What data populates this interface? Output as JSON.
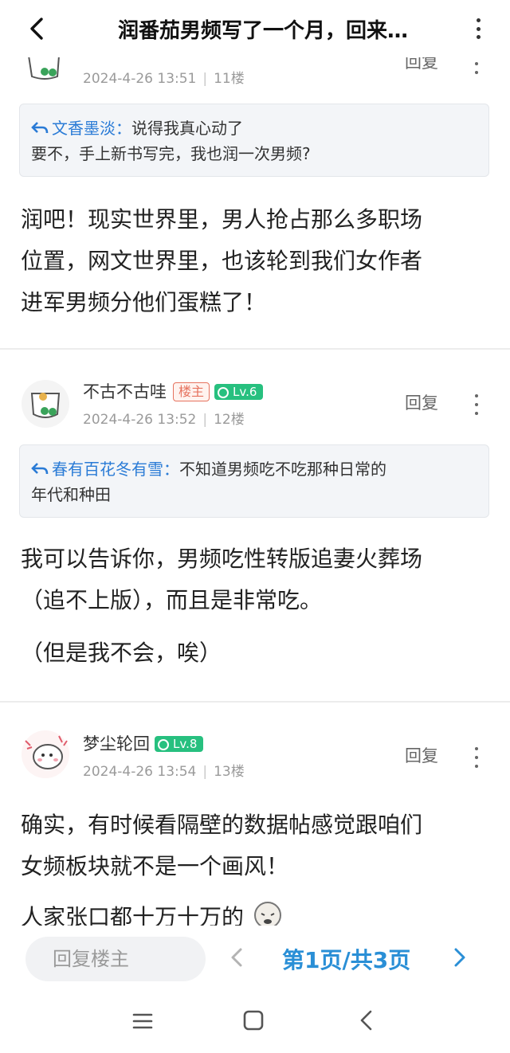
{
  "header": {
    "title": "润番茄男频写了一个月，回来…"
  },
  "posts": [
    {
      "time": "2024-4-26 13:51",
      "floor": "11楼",
      "reply_label": "回复",
      "quote": {
        "name": "文香墨淡：",
        "text_inline": "说得我真心动了",
        "text_line2": "要不，手上新书写完，我也润一次男频?"
      },
      "body": [
        "润吧！现实世界里，男人抢占那么多职场",
        "位置，网文世界里，也该轮到我们女作者",
        "进军男频分他们蛋糕了！"
      ]
    },
    {
      "username": "不古不古哇",
      "lz_badge": "楼主",
      "level": "Lv.6",
      "time": "2024-4-26 13:52",
      "floor": "12楼",
      "reply_label": "回复",
      "quote": {
        "name": "春有百花冬有雪：",
        "text_inline": "不知道男频吃不吃那种日常的",
        "text_line2": "年代和种田"
      },
      "body": [
        "我可以告诉你，男频吃性转版追妻火葬场",
        "（追不上版），而且是非常吃。",
        "（但是我不会，唉）"
      ]
    },
    {
      "username": "梦尘轮回",
      "level": "Lv.8",
      "time": "2024-4-26 13:54",
      "floor": "13楼",
      "reply_label": "回复",
      "body": [
        "确实，有时候看隔壁的数据帖感觉跟咱们",
        "女频板块就不是一个画风！",
        "人家张口都十万十万的"
      ]
    }
  ],
  "bottom": {
    "reply_placeholder": "回复楼主",
    "page_info": "第1页/共3页"
  },
  "colors": {
    "accent": "#2a8fd6",
    "link": "#2a7bd6",
    "level": "#27c07f",
    "lz": "#e6735f"
  }
}
